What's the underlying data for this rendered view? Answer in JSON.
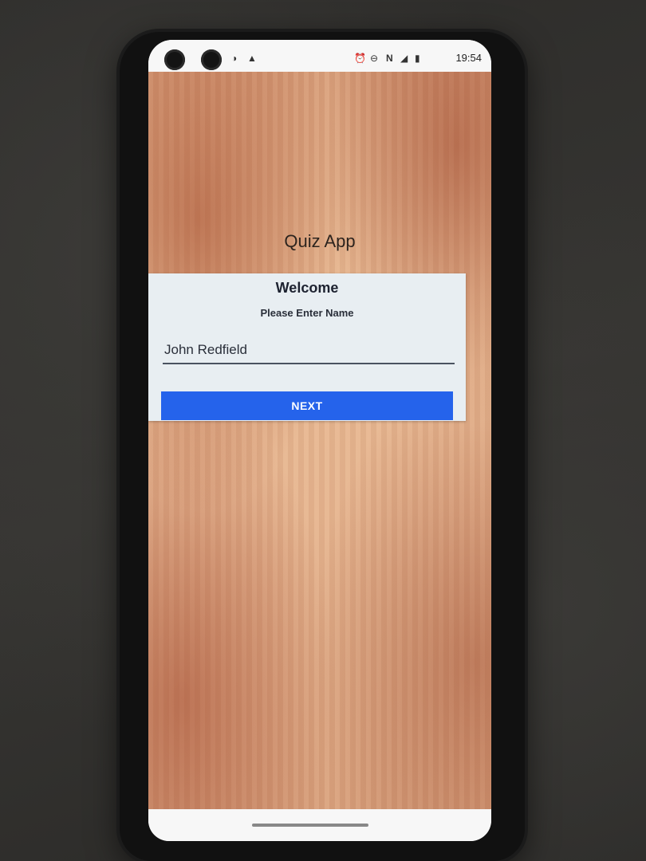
{
  "status_bar": {
    "time": "19:54",
    "icons": [
      "notification-icon",
      "warning-icon",
      "alarm-icon",
      "sync-icon",
      "nfc-icon",
      "signal-icon",
      "battery-icon"
    ]
  },
  "app": {
    "title": "Quiz App"
  },
  "card": {
    "heading": "Welcome",
    "prompt": "Please Enter Name",
    "name_value": "John Redfield",
    "next_label": "NEXT"
  },
  "colors": {
    "button": "#2563eb",
    "card": "#e8eef2",
    "background": "#e6b590"
  }
}
